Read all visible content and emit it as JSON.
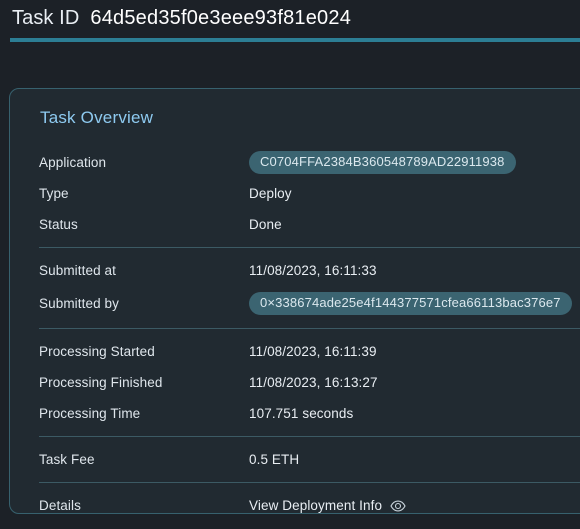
{
  "header": {
    "label": "Task ID",
    "value": "64d5ed35f0e3eee93f81e024",
    "accent_color": "#2c7e94"
  },
  "card": {
    "title": "Task Overview",
    "border_color": "#37616e",
    "background": "#212a31",
    "title_color": "#8ecaf0",
    "chip_background": "#3b6471",
    "divider_color": "#3c5a64",
    "rows": [
      {
        "label": "Application",
        "value": "C0704FFA2384B360548789AD22911938",
        "style": "chip"
      },
      {
        "label": "Type",
        "value": "Deploy",
        "style": "text"
      },
      {
        "label": "Status",
        "value": "Done",
        "style": "text"
      },
      {
        "label": "Submitted at",
        "value": "11/08/2023, 16:11:33",
        "style": "text"
      },
      {
        "label": "Submitted by",
        "value": "0×338674ade25e4f144377571cfea66113bac376e7",
        "style": "chip"
      },
      {
        "label": "Processing Started",
        "value": "11/08/2023, 16:11:39",
        "style": "text"
      },
      {
        "label": "Processing Finished",
        "value": "11/08/2023, 16:13:27",
        "style": "text"
      },
      {
        "label": "Processing Time",
        "value": "107.751 seconds",
        "style": "text"
      },
      {
        "label": "Task Fee",
        "value": "0.5 ETH",
        "style": "text"
      },
      {
        "label": "Details",
        "value": "View Deployment Info",
        "style": "link",
        "icon": "eye-icon"
      }
    ]
  }
}
